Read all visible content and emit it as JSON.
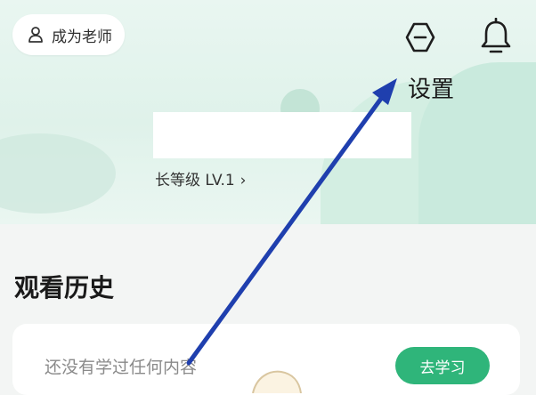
{
  "header": {
    "teacher_label": "成为老师",
    "settings_icon": "settings-icon",
    "bell_icon": "bell-icon"
  },
  "annotation": {
    "settings_label": "设置",
    "arrow_color": "#1f3fae"
  },
  "profile": {
    "level_text": "长等级 LV.1",
    "level_chevron": "›"
  },
  "history": {
    "title": "观看历史",
    "empty_text": "还没有学过任何内容",
    "learn_button": "去学习"
  },
  "colors": {
    "accent": "#2fb57a",
    "hero_bg": "#dff2ea"
  }
}
